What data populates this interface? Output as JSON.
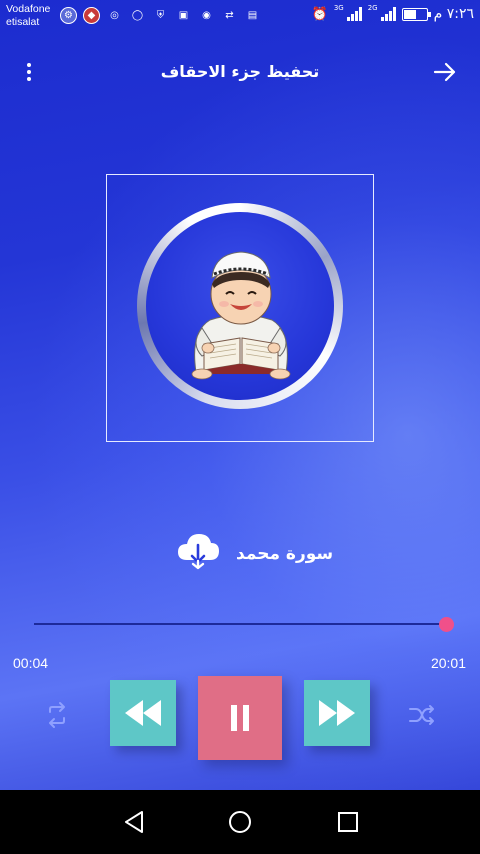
{
  "status_bar": {
    "carrier_line1": "Vodafone",
    "carrier_line2": "etisalat",
    "network_1": "3G",
    "network_2": "2G",
    "clock": "٧:٢٦ م",
    "notification_icons": [
      "vpn-icon",
      "app-icon",
      "settings-icon",
      "chat-icon",
      "shield-icon",
      "gallery-icon",
      "whatsapp-icon",
      "sync-icon",
      "storage-icon"
    ]
  },
  "toolbar": {
    "title": "تحفيظ جزء الاحقاف",
    "menu_icon": "more-vert-icon",
    "back_icon": "arrow-right-icon"
  },
  "track": {
    "title": "سورة محمد",
    "download_icon": "cloud-download-icon"
  },
  "player": {
    "current_time": "00:04",
    "duration": "20:01",
    "progress_fraction": 1.0,
    "is_playing": true
  },
  "colors": {
    "background_top": "#1c2ccf",
    "background_bottom": "#5c74f5",
    "accent_teal": "#5ec7c7",
    "accent_pink": "#e06e86",
    "seek_thumb": "#f0508a"
  }
}
